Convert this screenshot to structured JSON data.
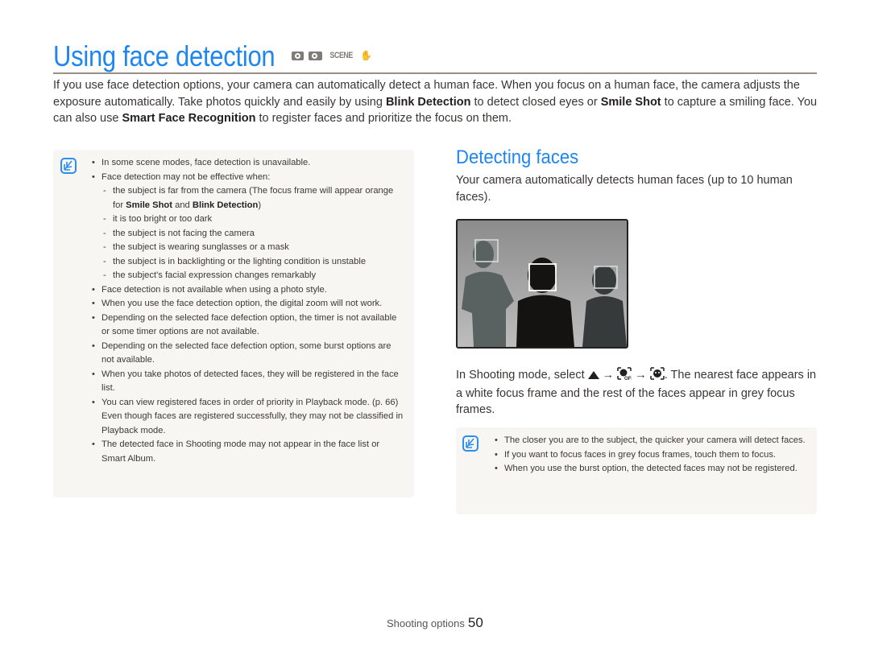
{
  "header": {
    "title": "Using face detection",
    "mode_icons": [
      "camera-auto-icon",
      "camera-program-icon",
      "scene-mode-icon",
      "dual-is-icon"
    ],
    "scene_label": "SCENE"
  },
  "intro": {
    "part1": "If you use face detection options, your camera can automatically detect a human face. When you focus on a human face, the camera adjusts the exposure automatically. Take photos quickly and easily by using ",
    "bold1": "Blink Detection",
    "part2": " to detect closed eyes or ",
    "bold2": "Smile Shot",
    "part3": " to capture a smiling face. You can also use ",
    "bold3": "Smart Face Recognition",
    "part4": " to register faces and prioritize the focus on them."
  },
  "note1": {
    "items": [
      "In some scene modes, face detection is unavailable.",
      "Face detection may not be effective when:",
      "Face detection is not available when using a photo style.",
      "When you use the face detection option, the digital zoom will not work.",
      "Depending on the selected face defection option, the timer is not available or some timer options are not available.",
      "Depending on the selected face defection option, some burst options are not available.",
      "When you take photos of detected faces, they will be registered in the face list.",
      "You can view registered faces in order of priority in Playback mode. (p. 66) Even though faces are registered successfully, they may not be classified in Playback mode.",
      "The detected face in Shooting mode may not appear in the face list or Smart Album."
    ],
    "sub": {
      "s1a": "the subject is far from the camera (The focus frame will appear orange for ",
      "s1b": "Smile Shot",
      "s1c": " and ",
      "s1d": "Blink Detection",
      "s1e": ")",
      "s2": "it is too bright or too dark",
      "s3": "the subject is not facing the camera",
      "s4": "the subject is wearing sunglasses or a mask",
      "s5": "the subject is in backlighting or the lighting condition is unstable",
      "s6": "the subject's facial expression changes remarkably"
    }
  },
  "section": {
    "heading": "Detecting faces",
    "description": "Your camera automatically detects human faces (up to 10 human faces).",
    "instruction_pre": "In Shooting mode, select ",
    "arrow": "→",
    "instruction_post": ". The nearest face appears in a white focus frame and the rest of the faces appear in grey focus frames."
  },
  "note2": {
    "items": [
      "The closer you are to the subject, the quicker your camera will detect faces.",
      "If you want to focus faces in grey focus frames, touch them to focus.",
      "When you use the burst option, the detected faces may not be registered."
    ]
  },
  "footer": {
    "section": "Shooting options",
    "page": "50"
  },
  "colors": {
    "accent": "#1e86f0",
    "note_bg": "#f8f6f2",
    "rule": "#9a8d8a"
  }
}
